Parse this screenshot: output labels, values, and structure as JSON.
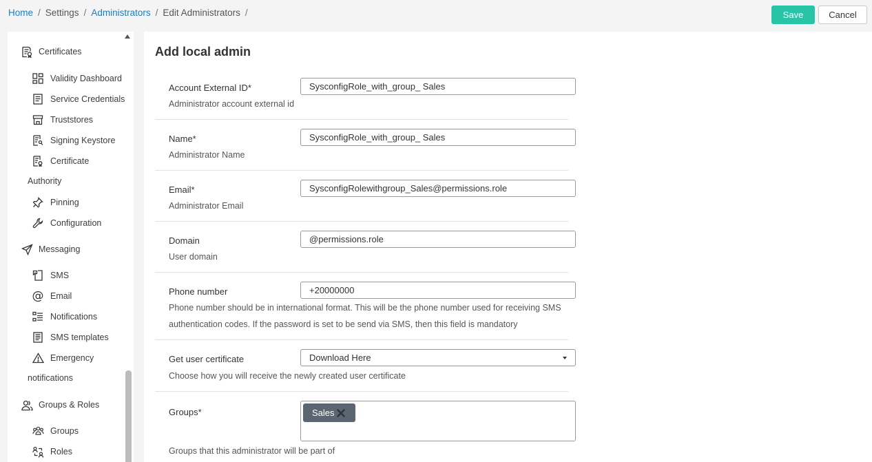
{
  "breadcrumb": {
    "home": "Home",
    "settings": "Settings",
    "administrators": "Administrators",
    "edit": "Edit Administrators",
    "separator": "/"
  },
  "toolbar": {
    "save_label": "Save",
    "cancel_label": "Cancel"
  },
  "sidebar": {
    "certificates": {
      "label": "Certificates",
      "icon": "certificate-icon",
      "items": [
        {
          "label": "Validity Dashboard",
          "icon": "dashboard-icon"
        },
        {
          "label": "Service Credentials",
          "icon": "document-icon"
        },
        {
          "label": "Truststores",
          "icon": "store-icon"
        },
        {
          "label": "Signing Keystore",
          "icon": "keystore-icon"
        },
        {
          "label": "Certificate",
          "label_cont": "Authority",
          "icon": "certificate-authority-icon"
        },
        {
          "label": "Pinning",
          "icon": "pin-icon"
        },
        {
          "label": "Configuration",
          "icon": "wrench-icon"
        }
      ]
    },
    "messaging": {
      "label": "Messaging",
      "icon": "send-icon",
      "items": [
        {
          "label": "SMS",
          "icon": "sms-icon"
        },
        {
          "label": "Email",
          "icon": "at-icon"
        },
        {
          "label": "Notifications",
          "icon": "list-icon"
        },
        {
          "label": "SMS templates",
          "icon": "template-icon"
        },
        {
          "label": "Emergency",
          "label_cont": "notifications",
          "icon": "warning-icon"
        }
      ]
    },
    "groups_roles": {
      "label": "Groups & Roles",
      "icon": "users-icon",
      "items": [
        {
          "label": "Groups",
          "icon": "groups-icon"
        },
        {
          "label": "Roles",
          "icon": "roles-icon"
        }
      ]
    }
  },
  "form": {
    "title": "Add local admin",
    "account_external_id": {
      "label": "Account External ID*",
      "value": "SysconfigRole_with_group_ Sales",
      "description": "Administrator account external id"
    },
    "name": {
      "label": "Name*",
      "value": "SysconfigRole_with_group_ Sales",
      "description": "Administrator Name"
    },
    "email": {
      "label": "Email*",
      "value": "SysconfigRolewithgroup_Sales@permissions.role",
      "description": "Administrator Email"
    },
    "domain": {
      "label": "Domain",
      "value": "@permissions.role",
      "description": "User domain"
    },
    "phone": {
      "label": "Phone number",
      "value": "+20000000",
      "description_line1": "Phone number should be in international format. This will be the phone number used for receiving SMS",
      "description_line2": "authentication codes. If the password is set to be send via SMS, then this field is mandatory"
    },
    "certificate": {
      "label": "Get user certificate",
      "selected": "Download Here",
      "description": "Choose how you will receive the newly created user certificate"
    },
    "groups": {
      "label": "Groups*",
      "tags": [
        "Sales"
      ],
      "description": "Groups that this administrator will be part of"
    }
  },
  "colors": {
    "accent": "#27c4a8",
    "link": "#1a7fc4",
    "tag": "#5b6670"
  }
}
